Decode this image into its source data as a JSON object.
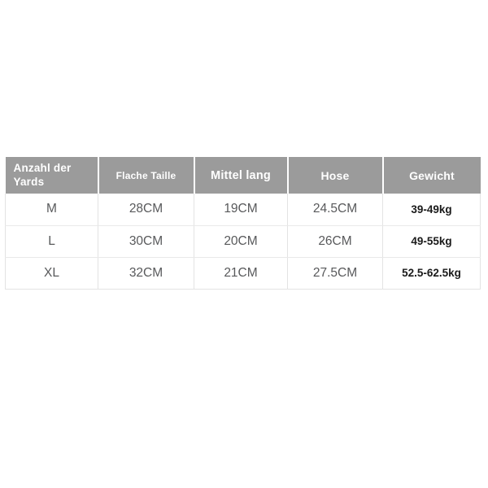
{
  "table": {
    "headers": [
      {
        "label": "Anzahl der Yards",
        "key": "size"
      },
      {
        "label": "Flache Taille",
        "key": "waist"
      },
      {
        "label": "Mittel lang",
        "key": "mid_length"
      },
      {
        "label": "Hose",
        "key": "pants"
      },
      {
        "label": "Gewicht",
        "key": "weight"
      }
    ],
    "rows": [
      {
        "size": "M",
        "waist": "28CM",
        "mid_length": "19CM",
        "pants": "24.5CM",
        "weight": "39-49kg"
      },
      {
        "size": "L",
        "waist": "30CM",
        "mid_length": "20CM",
        "pants": "26CM",
        "weight": "49-55kg"
      },
      {
        "size": "XL",
        "waist": "32CM",
        "mid_length": "21CM",
        "pants": "27.5CM",
        "weight": "52.5-62.5kg"
      }
    ]
  },
  "colors": {
    "header_background": "#9b9b9b",
    "header_text": "#ffffff",
    "cell_text": "#58595b",
    "weight_text": "#1a1a1a",
    "grid_line": "#e3e3e3",
    "page_background": "#ffffff"
  }
}
